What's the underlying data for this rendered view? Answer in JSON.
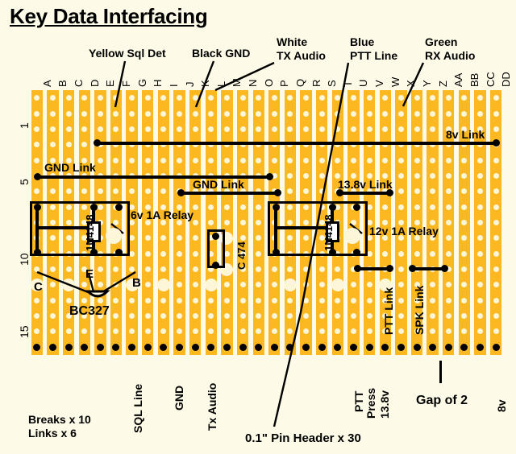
{
  "title": "Key Data Interfacing",
  "board": {
    "columns": [
      "A",
      "B",
      "C",
      "D",
      "E",
      "F",
      "G",
      "H",
      "I",
      "J",
      "K",
      "L",
      "M",
      "N",
      "O",
      "P",
      "Q",
      "R",
      "S",
      "T",
      "U",
      "V",
      "W",
      "X",
      "Y",
      "Z",
      "AA",
      "BB",
      "CC",
      "DD"
    ],
    "row_labels": [
      "1",
      "5",
      "10",
      "15"
    ],
    "rows_total": 17,
    "strip_color": "#fbb821",
    "hole_color": "#fdf6d8",
    "background_color": "#fdfbe8"
  },
  "top_callouts": [
    {
      "text_line1": "Yellow Sql Det",
      "text_line2": ""
    },
    {
      "text_line1": "Black GND",
      "text_line2": ""
    },
    {
      "text_line1": "White",
      "text_line2": "TX Audio"
    },
    {
      "text_line1": "Blue",
      "text_line2": "PTT Line"
    },
    {
      "text_line1": "Green",
      "text_line2": "RX Audio"
    }
  ],
  "links": [
    {
      "label": "8v Link"
    },
    {
      "label": "GND Link"
    },
    {
      "label": "GND Link"
    },
    {
      "label": "13.8v Link"
    },
    {
      "label": "PTT Link"
    },
    {
      "label": "SPK Link"
    }
  ],
  "components": [
    {
      "label": "6v 1A Relay"
    },
    {
      "label": "12v 1A Relay"
    },
    {
      "label": "1N4148"
    },
    {
      "label": "1N4148"
    },
    {
      "label": "C 474"
    },
    {
      "label": "BC327"
    }
  ],
  "transistor_pins": [
    "C",
    "E",
    "B"
  ],
  "bottom_labels": [
    {
      "text": "SQL Line"
    },
    {
      "text": "GND"
    },
    {
      "text": "Tx Audio"
    },
    {
      "text": "PTT"
    },
    {
      "text": "Press"
    },
    {
      "text": "13.8v"
    },
    {
      "text": "8v"
    }
  ],
  "notes": {
    "breaks": "Breaks x 10",
    "links": "Links x 6",
    "pin_header": "0.1\" Pin Header x 30",
    "gap": "Gap of 2"
  }
}
